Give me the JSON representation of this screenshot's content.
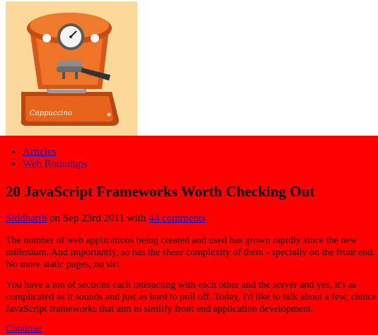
{
  "logo": {
    "icon": "espresso-machine-icon",
    "brand_text": "Cappuccino",
    "colors": {
      "background": "#fbd99a",
      "machine": "#e8641c"
    }
  },
  "nav": {
    "items": [
      {
        "label": "Articles"
      },
      {
        "label": "Web Roundups"
      }
    ]
  },
  "article": {
    "title": "20 JavaScript Frameworks Worth Checking Out",
    "author": "Siddharth",
    "date_text": " on Sep 23rd 2011 with ",
    "comments_link": "44 comments",
    "paragraph1_lines": [
      "The number of web applications being created and used has grown rapidly since the new",
      "millenium. And importantly, so has the sheer complexity of them - specially on the front end.",
      "No more static pages, no sir!"
    ],
    "paragraph2_lines": [
      "You have a ton of sections each interacting with each other and the server and yes, it's as",
      "complicated as it sounds and just as hard to pull off. Today, I'd like to talk about a few, choice",
      "JavaScript frameworks that aim to simlify front end application development."
    ],
    "continue_link": "Continue"
  },
  "colors": {
    "content_background": "#ff0000",
    "link": "#1a0dab"
  }
}
